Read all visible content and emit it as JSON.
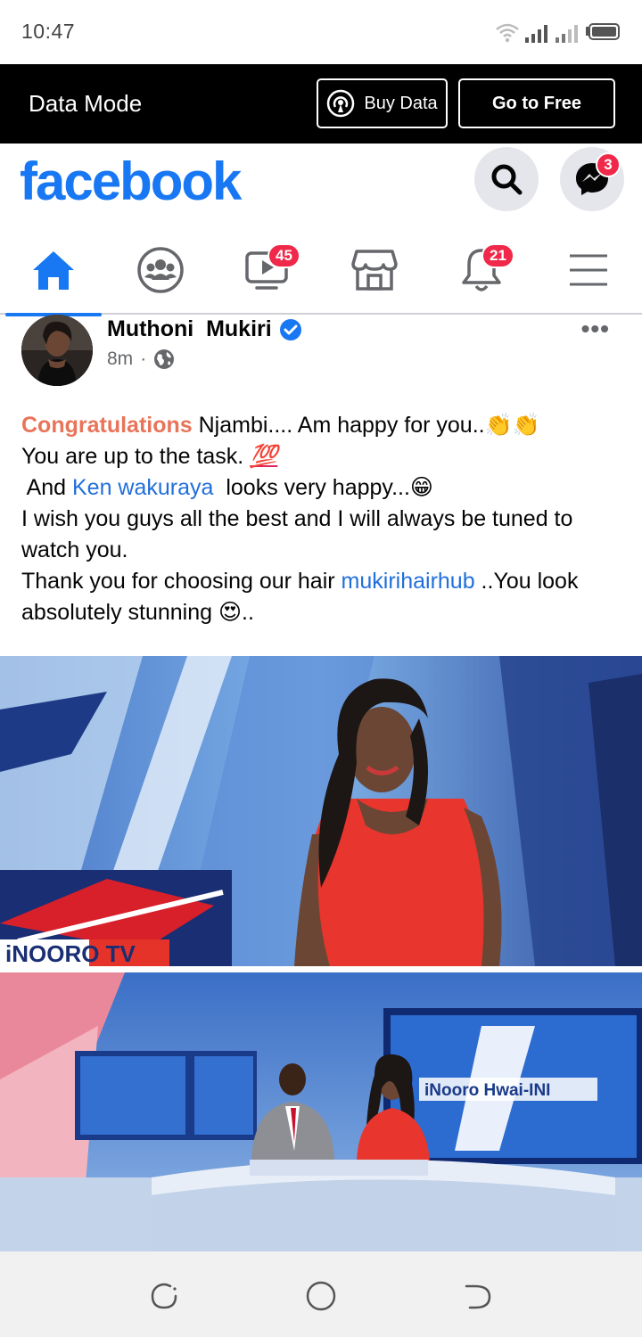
{
  "status_bar": {
    "time": "10:47"
  },
  "data_mode": {
    "title": "Data Mode",
    "buy_data_label": "Buy Data",
    "go_free_label": "Go to Free"
  },
  "header": {
    "logo": "facebook",
    "messenger_badge": "3"
  },
  "nav": {
    "watch_badge": "45",
    "notifications_badge": "21"
  },
  "post": {
    "author": "Muthoni  Mukiri",
    "time": "8m",
    "line1_highlight": "Congratulations",
    "line1_rest": " Njambi.... Am happy for you..",
    "line2": "You are up to the task. ",
    "line3_a": " And ",
    "line3_link": "Ken wakuraya",
    "line3_b": "  looks very happy...",
    "line4": "I wish you guys all the best and I will always be tuned to watch you.",
    "line5_a": "Thank you for choosing our hair ",
    "line5_link": "mukirihairhub",
    "line5_b": " ..You look absolutely stunning ",
    "line5_end": ".."
  },
  "photo1": {
    "logo_text": "iNOORO TV"
  },
  "photo2": {
    "screen_text": "iNooro Hwai-INI"
  },
  "colors": {
    "brand": "#1877f2",
    "badge": "#f02849",
    "highlight": "#e8745a"
  }
}
